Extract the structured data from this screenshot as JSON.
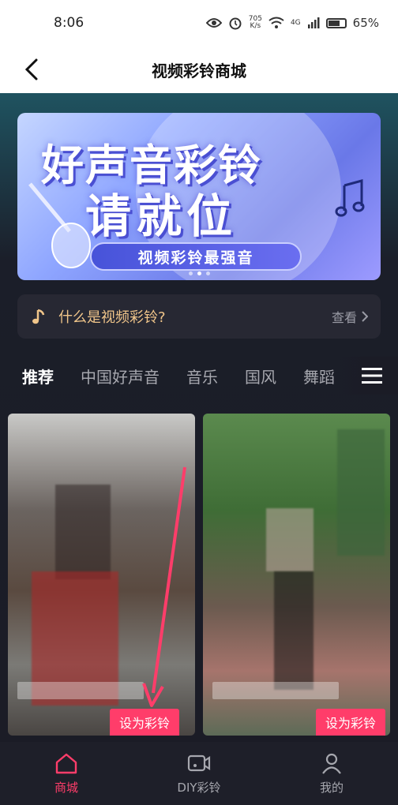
{
  "status_bar": {
    "time": "8:06",
    "speed_value": "705",
    "speed_unit": "K/s",
    "network": "4G",
    "battery": "65%"
  },
  "header": {
    "title": "视频彩铃商城"
  },
  "banner": {
    "title_line1": "好声音彩铃",
    "title_line2": "请就位",
    "pill_text": "视频彩铃最强音"
  },
  "info_bar": {
    "text": "什么是视频彩铃?",
    "link_label": "查看"
  },
  "tabs": [
    {
      "label": "推荐",
      "active": true
    },
    {
      "label": "中国好声音",
      "active": false
    },
    {
      "label": "音乐",
      "active": false
    },
    {
      "label": "国风",
      "active": false
    },
    {
      "label": "舞蹈",
      "active": false
    }
  ],
  "videos": [
    {
      "button_label": "设为彩铃"
    },
    {
      "button_label": "设为彩铃"
    }
  ],
  "bottom_nav": [
    {
      "label": "商城",
      "active": true
    },
    {
      "label": "DIY彩铃",
      "active": false
    },
    {
      "label": "我的",
      "active": false
    }
  ],
  "colors": {
    "accent": "#ff3d6a",
    "info_text": "#f0c58a",
    "background": "#1b1c26"
  }
}
